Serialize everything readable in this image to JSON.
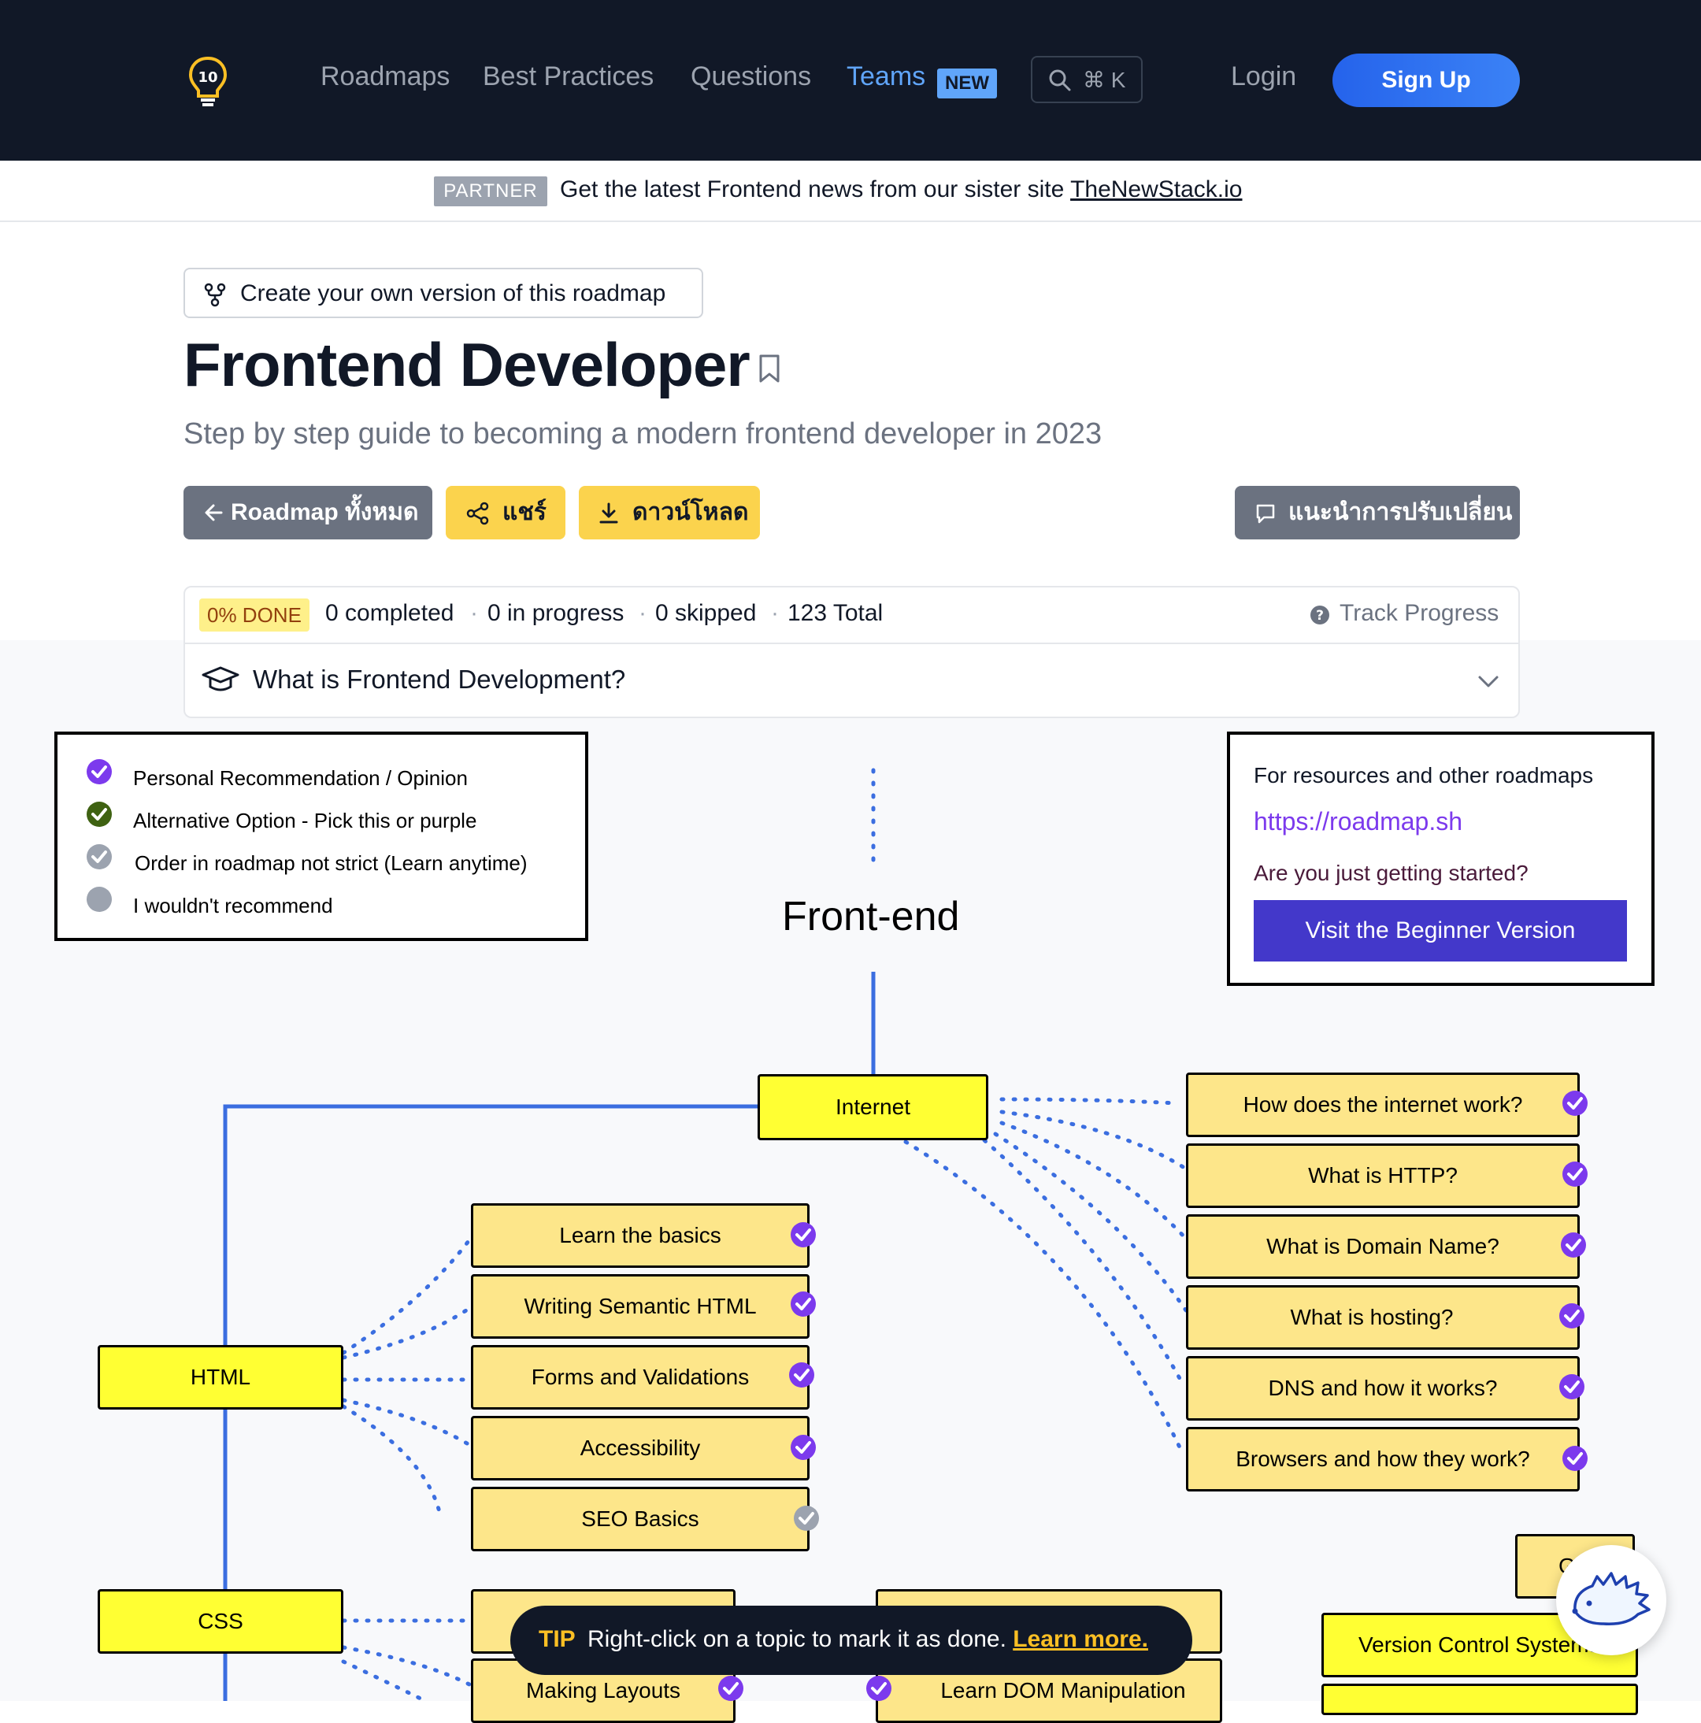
{
  "nav": {
    "links": [
      "Roadmaps",
      "Best Practices",
      "Questions",
      "Teams"
    ],
    "teams_badge": "NEW",
    "search_shortcut": "⌘ K",
    "login": "Login",
    "signup": "Sign Up"
  },
  "partner": {
    "badge": "PARTNER",
    "text": "Get the latest Frontend news from our sister site ",
    "link": "TheNewStack.io"
  },
  "header": {
    "create_version": "Create your own version of this roadmap",
    "title": "Frontend Developer",
    "subtitle": "Step by step guide to becoming a modern frontend developer in 2023",
    "buttons": {
      "all_roadmaps": "Roadmap ทั้งหมด",
      "share": "แชร์",
      "download": "ดาวน์โหลด",
      "suggest": "แนะนำการปรับเปลี่ยน"
    }
  },
  "progress": {
    "done": "0% DONE",
    "completed": "0 completed",
    "in_progress": "0 in progress",
    "skipped": "0 skipped",
    "total": "123 Total",
    "track": "Track Progress",
    "faq": "What is Frontend Development?"
  },
  "legend": {
    "items": [
      {
        "label": "Personal Recommendation / Opinion",
        "color": "#7c3aed"
      },
      {
        "label": "Alternative Option - Pick this or purple",
        "color": "#3f6212"
      },
      {
        "label": "Order in roadmap not strict (Learn anytime)",
        "color": "#9ca3af"
      },
      {
        "label": "I wouldn't recommend",
        "color": "#9ca3af"
      }
    ]
  },
  "resources": {
    "title": "For resources and other roadmaps",
    "link": "https://roadmap.sh",
    "question": "Are you just getting started?",
    "button": "Visit the Beginner Version"
  },
  "roadmap": {
    "title": "Front-end",
    "internet": "Internet",
    "internet_topics": [
      "How does the internet work?",
      "What is HTTP?",
      "What is Domain Name?",
      "What is hosting?",
      "DNS and how it works?",
      "Browsers and how they work?"
    ],
    "html": "HTML",
    "html_topics": [
      {
        "label": "Learn the basics",
        "status": "recommended"
      },
      {
        "label": "Writing Semantic HTML",
        "status": "recommended"
      },
      {
        "label": "Forms and Validations",
        "status": "recommended"
      },
      {
        "label": "Accessibility",
        "status": "recommended"
      },
      {
        "label": "SEO Basics",
        "status": "any-order"
      }
    ],
    "css": "CSS",
    "css_topics": [
      "Making Layouts"
    ],
    "js_topic": "Learn DOM Manipulation",
    "vcs": "Version Control Systems",
    "partial_node": "G"
  },
  "tip": {
    "label": "TIP",
    "text": "Right-click on a topic to mark it as done. ",
    "link": "Learn more."
  },
  "colors": {
    "nav_bg": "#111827",
    "accent_blue": "#60a5fa",
    "main_node": "#ffff33",
    "topic_node": "#fde68a",
    "purple_check": "#7c3aed"
  }
}
